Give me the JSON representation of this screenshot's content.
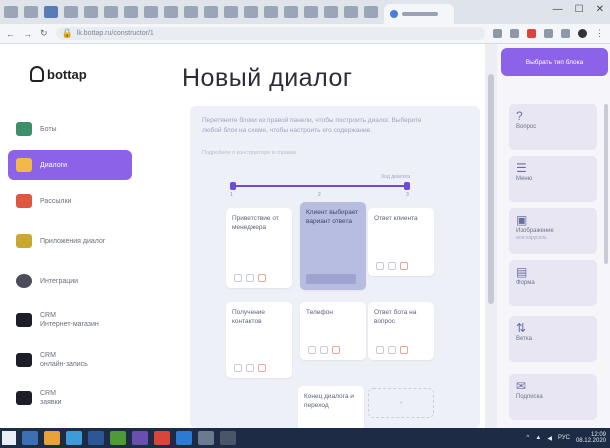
{
  "browser": {
    "url": "lk.bottap.ru/constructor/1",
    "window_controls": [
      "—",
      "☐",
      "✕"
    ]
  },
  "sidebar": {
    "logo": "bottap",
    "items": [
      {
        "label": "Боты",
        "icon": "bot-icon",
        "color": "#3d8f6a",
        "active": false
      },
      {
        "label": "Диалоги",
        "icon": "dialog-icon",
        "color": "#f2b84b",
        "active": true
      },
      {
        "label": "Рассылки",
        "icon": "mailing-icon",
        "color": "#e0573f",
        "active": false
      },
      {
        "label": "Приложения диалог",
        "icon": "app-icon",
        "color": "#c9a832",
        "active": false
      },
      {
        "label": "Интеграции",
        "icon": "integration-icon",
        "color": "#4c4c5a",
        "active": false
      },
      {
        "label": "CRM",
        "label2": "Интернет-магазин",
        "icon": "crm-icon",
        "color": "#1e1e28",
        "active": false
      },
      {
        "label": "CRM",
        "label2": "онлайн-запись",
        "icon": "crm-icon",
        "color": "#1e1e28",
        "active": false
      },
      {
        "label": "CRM",
        "label2": "заявки",
        "icon": "crm-icon",
        "color": "#1e1e28",
        "active": false
      }
    ]
  },
  "main": {
    "title": "Новый диалог",
    "hint": "Перетяните блоки из правой панели, чтобы построить диалог. Выберите любой блок на схеме, чтобы настроить его содержание.",
    "hint_sub": "Подробнее о конструкторе в справке",
    "timeline": {
      "ticks": [
        "1",
        "2",
        "3"
      ],
      "label": "Ход диалога"
    },
    "cards": [
      {
        "text": "Приветствие от менеджера",
        "selected": false
      },
      {
        "text": "Клиент выбирает вариант ответа",
        "selected": true
      },
      {
        "text": "Ответ клиента",
        "selected": false
      },
      {
        "text": "Получение контактов",
        "selected": false
      },
      {
        "text": "Телефон",
        "selected": false
      },
      {
        "text": "Ответ бота на вопрос",
        "selected": false
      },
      {
        "text": "Конец диалога и переход",
        "selected": false
      }
    ],
    "add_label": "+"
  },
  "right_panel": {
    "top_button": "Выбрать тип блока",
    "blocks": [
      {
        "icon": "?",
        "label": "Вопрос",
        "sub": ""
      },
      {
        "icon": "☰",
        "label": "Меню",
        "sub": ""
      },
      {
        "icon": "▣",
        "label": "Изображение",
        "sub": "или карусель"
      },
      {
        "icon": "▤",
        "label": "Форма",
        "sub": ""
      },
      {
        "icon": "⇅",
        "label": "Ветка",
        "sub": ""
      },
      {
        "icon": "✉",
        "label": "Подписка",
        "sub": ""
      }
    ]
  },
  "taskbar": {
    "time": "12:09",
    "date": "08.12.2020",
    "lang": "РУС"
  },
  "colors": {
    "accent": "#8c62e8",
    "canvas": "#eef0f7",
    "selected_card": "#b7bde0"
  }
}
